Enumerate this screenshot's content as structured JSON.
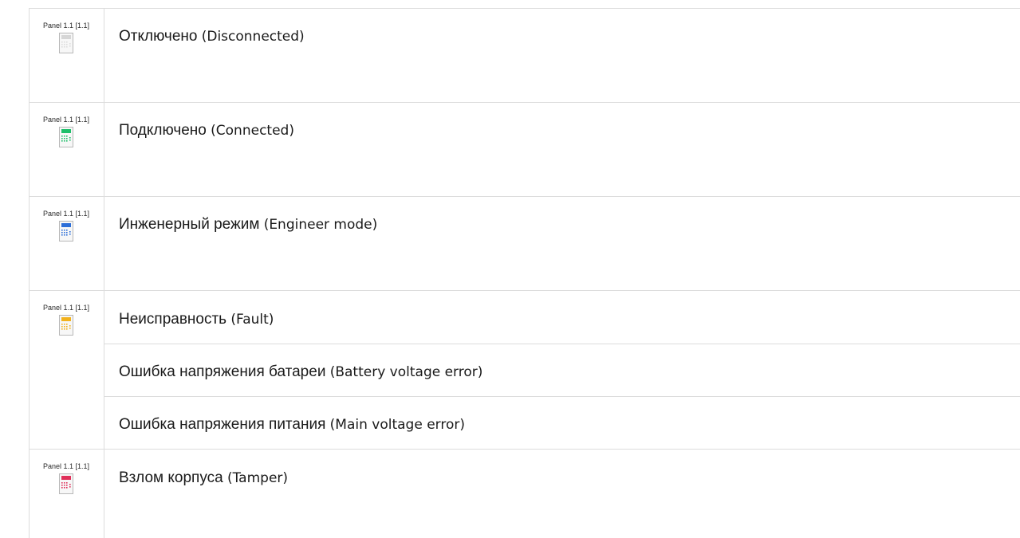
{
  "rows": [
    {
      "icon": {
        "label": "Panel 1.1 [1.1]",
        "name": "panel-disconnected-icon",
        "state_color": "#d6d6d6",
        "key_color": "#dddddd"
      },
      "lines": [
        {
          "ru": "Отключено",
          "en": "(Disconnected)"
        }
      ]
    },
    {
      "icon": {
        "label": "Panel 1.1 [1.1]",
        "name": "panel-connected-icon",
        "state_color": "#1fbf6a",
        "key_color": "#1fbf6a"
      },
      "lines": [
        {
          "ru": "Подключено",
          "en": "(Connected)"
        }
      ]
    },
    {
      "icon": {
        "label": "Panel 1.1 [1.1]",
        "name": "panel-engineer-mode-icon",
        "state_color": "#2d6fd8",
        "key_color": "#2d6fd8"
      },
      "lines": [
        {
          "ru": "Инженерный режим",
          "en": "(Engineer mode)"
        }
      ]
    },
    {
      "icon": {
        "label": "Panel 1.1 [1.1]",
        "name": "panel-fault-icon",
        "state_color": "#f2b21d",
        "key_color": "#f2b21d"
      },
      "lines": [
        {
          "ru": "Неисправность",
          "en": "(Fault)"
        },
        {
          "ru": "Ошибка напряжения батареи",
          "en": "(Battery voltage error)"
        },
        {
          "ru": "Ошибка напряжения питания",
          "en": "(Main voltage error)"
        }
      ]
    },
    {
      "icon": {
        "label": "Panel 1.1 [1.1]",
        "name": "panel-tamper-icon",
        "state_color": "#e0305a",
        "key_color": "#e0305a"
      },
      "lines": [
        {
          "ru": "Взлом корпуса",
          "en": "(Tamper)"
        }
      ]
    }
  ]
}
